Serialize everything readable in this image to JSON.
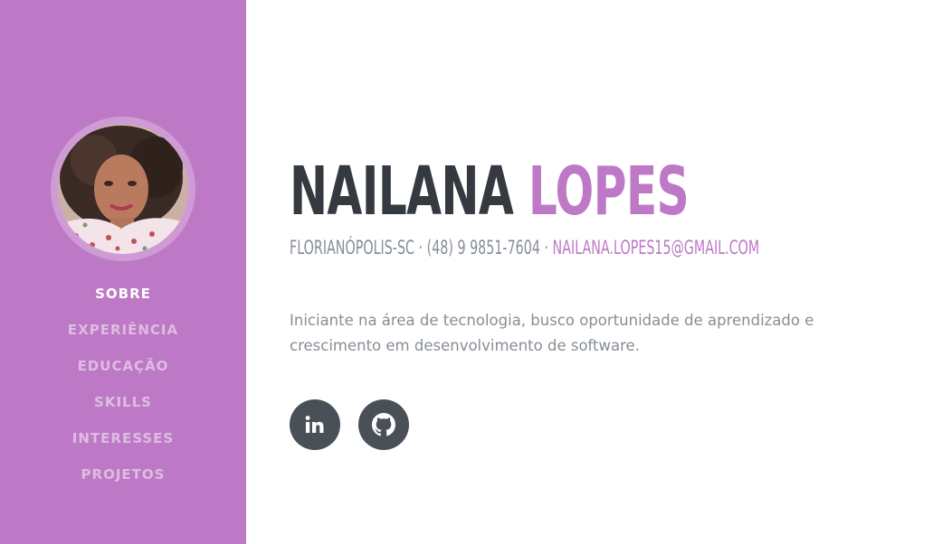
{
  "sidebar": {
    "avatar_alt": "Nailana Lopes profile photo",
    "nav": [
      {
        "label": "SOBRE",
        "active": true
      },
      {
        "label": "EXPERIÊNCIA",
        "active": false
      },
      {
        "label": "EDUCAÇÃO",
        "active": false
      },
      {
        "label": "SKILLS",
        "active": false
      },
      {
        "label": "INTERESSES",
        "active": false
      },
      {
        "label": "PROJETOS",
        "active": false
      }
    ]
  },
  "hero": {
    "first_name": "NAILANA",
    "last_name": "LOPES",
    "location": "FLORIANÓPOLIS-SC",
    "separator": " · ",
    "phone": "(48) 9 9851-7604",
    "email": "NAILANA.LOPES15@GMAIL.COM",
    "lead": "Iniciante na área de tecnologia, busco oportunidade de aprendizado e crescimento em desenvolvimento de software."
  },
  "social": [
    {
      "icon": "linkedin-icon"
    },
    {
      "icon": "github-icon"
    }
  ],
  "colors": {
    "primary": "#bd79c5",
    "heading": "#343a40",
    "muted": "#868e96",
    "social_bg": "#495057"
  }
}
